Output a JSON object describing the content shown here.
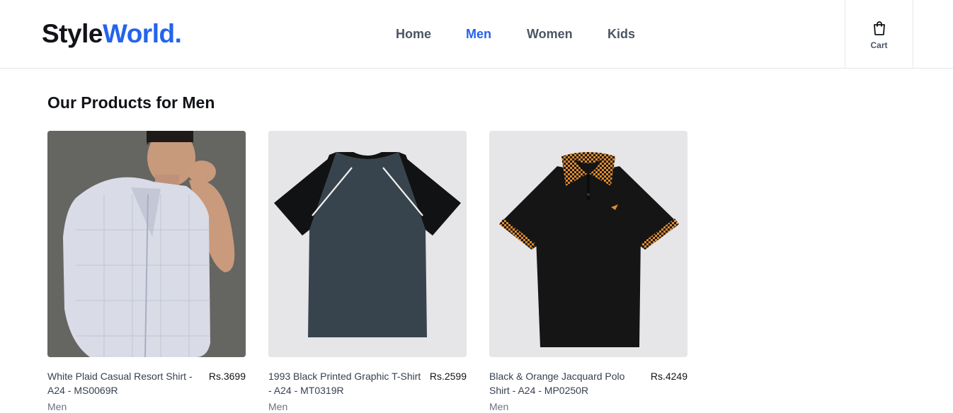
{
  "brand": {
    "part1": "Style",
    "part2": "World."
  },
  "nav": {
    "home": "Home",
    "men": "Men",
    "women": "Women",
    "kids": "Kids"
  },
  "cart": {
    "label": "Cart"
  },
  "page": {
    "title": "Our Products for Men"
  },
  "products": [
    {
      "name": "White Plaid Casual Resort Shirt - A24 - MS0069R",
      "price": "Rs.3699",
      "category": "Men"
    },
    {
      "name": "1993 Black Printed Graphic T-Shirt - A24 - MT0319R",
      "price": "Rs.2599",
      "category": "Men"
    },
    {
      "name": "Black & Orange Jacquard Polo Shirt - A24 - MP0250R",
      "price": "Rs.4249",
      "category": "Men"
    }
  ],
  "colors": {
    "accent": "#2563eb",
    "text": "#111318",
    "muted": "#6b7280"
  }
}
